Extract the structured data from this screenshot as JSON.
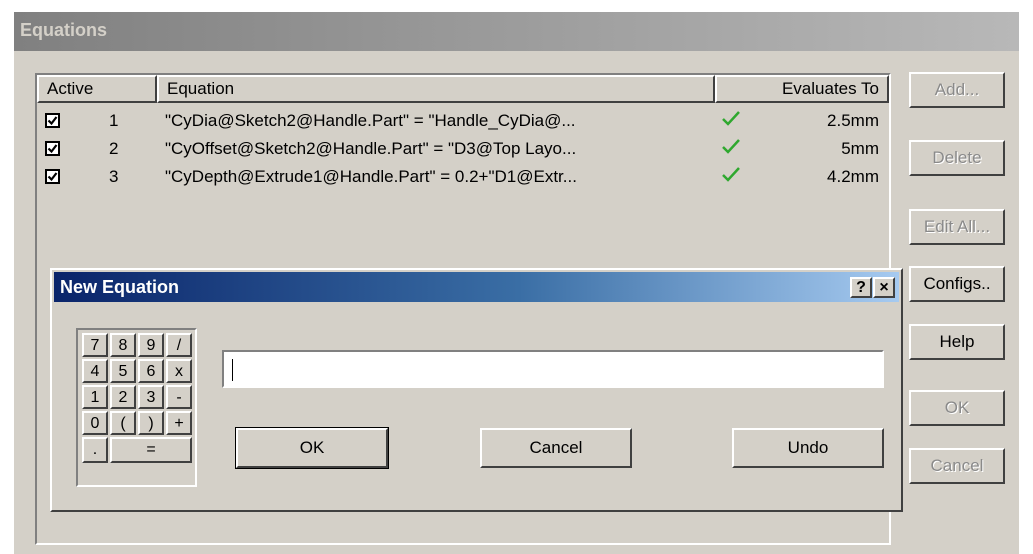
{
  "window": {
    "title": "Equations"
  },
  "table": {
    "headers": {
      "active": "Active",
      "equation": "Equation",
      "evaluates": "Evaluates To"
    },
    "rows": [
      {
        "num": "1",
        "equation": "\"CyDia@Sketch2@Handle.Part\" = \"Handle_CyDia@...",
        "value": "2.5mm",
        "active": true
      },
      {
        "num": "2",
        "equation": "\"CyOffset@Sketch2@Handle.Part\" = \"D3@Top Layo...",
        "value": "5mm",
        "active": true
      },
      {
        "num": "3",
        "equation": "\"CyDepth@Extrude1@Handle.Part\" = 0.2+\"D1@Extr...",
        "value": "4.2mm",
        "active": true
      }
    ]
  },
  "side_buttons": {
    "add": "Add...",
    "delete": "Delete",
    "edit_all": "Edit All...",
    "configs": "Configs..",
    "help": "Help",
    "ok": "OK",
    "cancel": "Cancel"
  },
  "dialog": {
    "title": "New Equation",
    "help_btn": "?",
    "close_btn": "×",
    "input_value": "",
    "ok": "OK",
    "cancel": "Cancel",
    "undo": "Undo",
    "keypad": {
      "r1": [
        "7",
        "8",
        "9",
        "/"
      ],
      "r2": [
        "4",
        "5",
        "6",
        "x"
      ],
      "r3": [
        "1",
        "2",
        "3",
        "-"
      ],
      "r4": [
        "0",
        "(",
        ")",
        "+"
      ],
      "dot": ".",
      "equals": "="
    }
  },
  "colors": {
    "check_green": "#2fa82f",
    "title_active": "#0a246a",
    "title_inactive": "#808080"
  }
}
